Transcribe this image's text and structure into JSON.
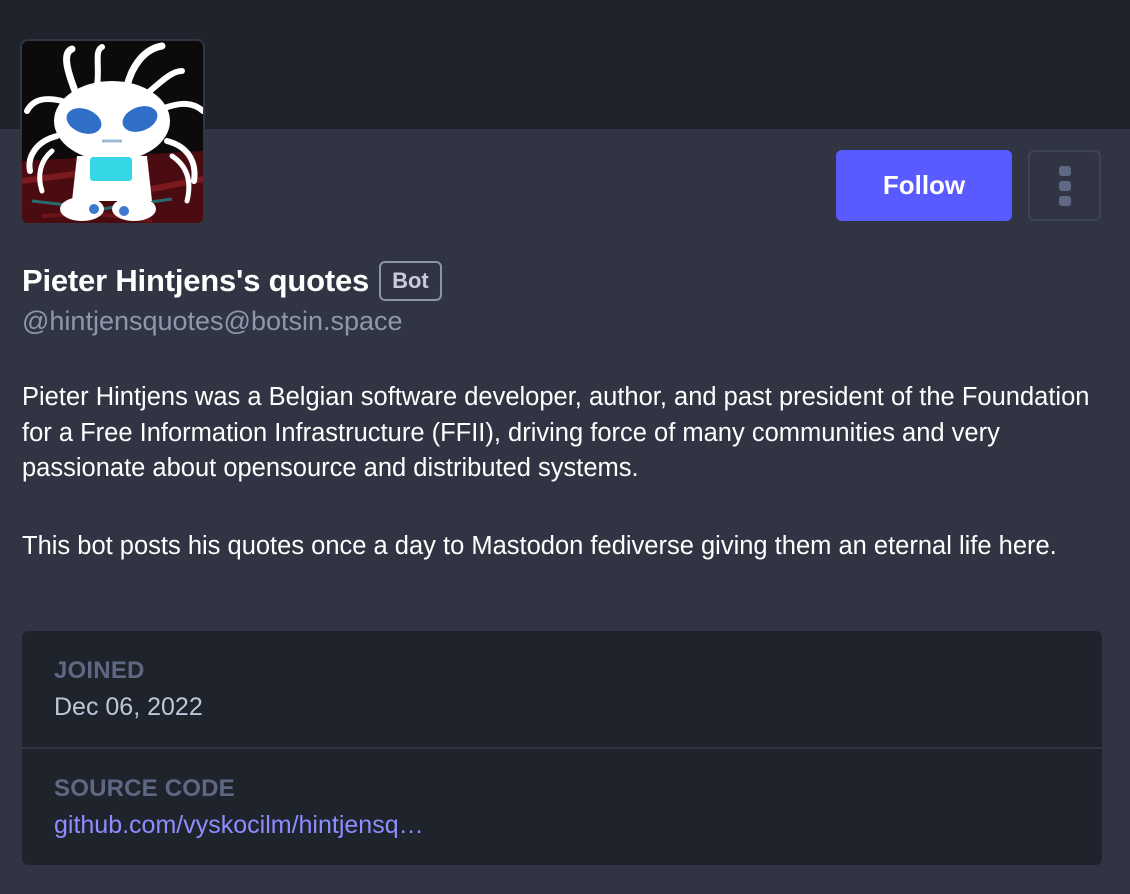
{
  "profile": {
    "display_name": "Pieter Hintjens's quotes",
    "bot_badge": "Bot",
    "handle": "@hintjensquotes@botsin.space",
    "avatar_icon": "robot-avatar-icon"
  },
  "actions": {
    "follow_label": "Follow",
    "menu_icon": "more-vertical-icon"
  },
  "bio": {
    "paragraphs": [
      "Pieter Hintjens was a Belgian software developer, author, and past president of the Foundation for a Free Information Infrastructure (FFII), driving force of many communities and very passionate about opensource and distributed systems.",
      "This bot posts his quotes once a day to Mastodon fediverse giving them an eternal life here."
    ]
  },
  "fields": [
    {
      "label": "JOINED",
      "value": "Dec 06, 2022"
    },
    {
      "label": "SOURCE CODE",
      "value": "github.com/vyskocilm/hintjensq…"
    }
  ],
  "colors": {
    "background": "#313543",
    "header_band": "#1f232b",
    "accent": "#595aff",
    "link": "#8c8dff"
  }
}
